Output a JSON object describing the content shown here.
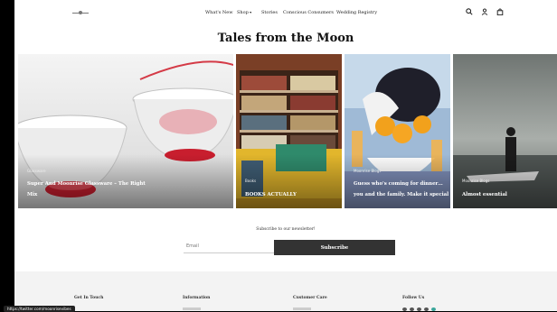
{
  "header": {
    "nav": [
      "What's New",
      "Shop",
      "Stories",
      "Conscious Consumers",
      "Wedding Registry"
    ],
    "icons": [
      "search-icon",
      "user-icon",
      "bag-icon"
    ]
  },
  "page_title": "Tales from the Moon",
  "cards": [
    {
      "category": "Glassware",
      "title_line1": "Super And Moonrise Glassware – The Right",
      "title_line2": "Mix"
    },
    {
      "category": "Books",
      "title_line1": "BOOKS ACTUALLY",
      "title_line2": ""
    },
    {
      "category": "Moonrise Blogs",
      "title_line1": "Guess who's coming for dinner…",
      "title_line2": "you and the family. Make it special"
    },
    {
      "category": "Moonrise Blogs",
      "title_line1": "Almost essential",
      "title_line2": ""
    }
  ],
  "newsletter": {
    "label": "Subscribe to our newsletter!",
    "email_placeholder": "Email",
    "button": "Subscribe"
  },
  "footer": {
    "columns": [
      "Get In Touch",
      "Information",
      "Customer Care",
      "Follow Us"
    ]
  },
  "status_url": "https://twitter.com/moonrisevibes"
}
